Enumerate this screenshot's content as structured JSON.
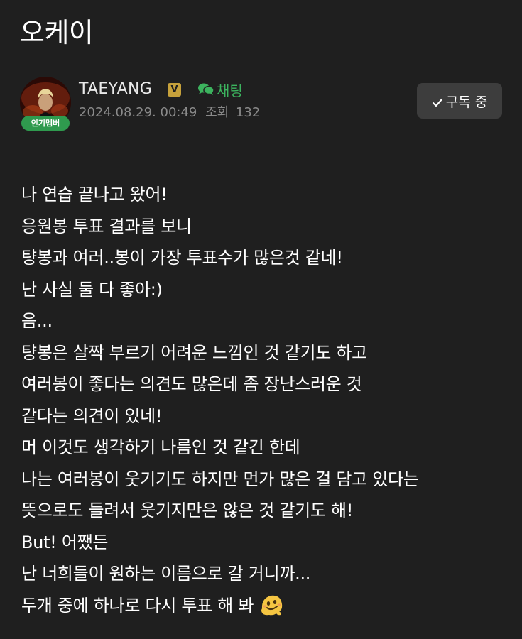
{
  "post": {
    "title": "오케이",
    "author": {
      "name": "TAEYANG",
      "verified_mark": "V",
      "member_badge": "인기멤버",
      "avatar_icon": "profile-photo"
    },
    "chat_label": "채팅",
    "chat_icon": "chat-bubbles-icon",
    "date": "2024.08.29. 00:49",
    "views_label": "조회",
    "views_count": "132",
    "subscribe_label": "구독 중",
    "subscribe_icon": "check-icon",
    "body_lines": [
      "나 연습 끝나고 왔어!",
      "응원봉 투표 결과를 보니",
      "턍봉과 여러..봉이 가장 투표수가 많은것 같네!",
      "난 사실 둘 다 좋아:)",
      "음...",
      "턍봉은 살짝 부르기 어려운 느낌인 것 같기도 하고",
      "여러봉이 좋다는 의견도 많은데 좀 장난스러운 것",
      "같다는 의견이 있네!",
      "머 이것도 생각하기 나름인 것 같긴 한데",
      "나는 여러봉이 웃기기도 하지만 먼가 많은 걸 담고 있다는",
      "뜻으로도 들려서 웃기지만은 않은 것 같기도 해!",
      "But! 어쨌든",
      "난 너희들이 원하는 이름으로 갈 거니까...",
      "두개 중에 하나로 다시 투표 해 봐"
    ],
    "ending_emoji": "melting-face-emoji"
  },
  "colors": {
    "background": "#1f1f1f",
    "accent_green": "#3cb35e",
    "badge_green": "#2f9a4e",
    "verified_gold": "#c6a13b",
    "meta_gray": "#8a8a8a",
    "button_bg": "#3d3d3d"
  }
}
